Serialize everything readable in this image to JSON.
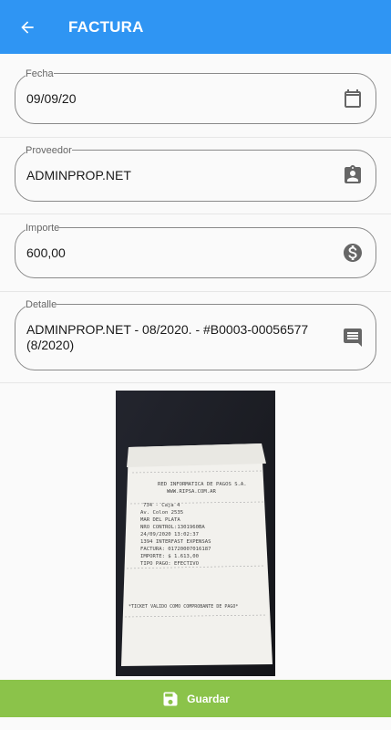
{
  "appbar": {
    "title": "FACTURA",
    "back_icon": "arrow-back-icon"
  },
  "fields": {
    "fecha": {
      "label": "Fecha",
      "value": "09/09/20",
      "icon": "calendar-icon"
    },
    "proveedor": {
      "label": "Proveedor",
      "value": "ADMINPROP.NET",
      "icon": "contact-card-icon"
    },
    "importe": {
      "label": "Importe",
      "value": "600,00",
      "icon": "dollar-circle-icon"
    },
    "detalle": {
      "label": "Detalle",
      "value_line1": "ADMINPROP.NET - 08/2020. - #B0003-00056577",
      "value_line2": "(8/2020)",
      "icon": "comment-icon"
    }
  },
  "receipt": {
    "lines": [
      "RED INFORMATICA DE PAGOS S.A.",
      "WWW.RIPSA.COM.AR",
      "734    - Caja 4",
      "Av. Colon 2535",
      "MAR DEL PLATA",
      "NRO CONTROL:1301960BA",
      "24/09/2020 13:02:37",
      "1394 INTERFAST EXPENSAS",
      "FACTURA: 01720007016187",
      "IMPORTE:     $ 1.613,00",
      "TIPO PAGO: EFECTIVO",
      "*TICKET VALIDO COMO COMPROBANTE DE PAGO*"
    ]
  },
  "save_button": {
    "label": "Guardar",
    "icon": "save-icon"
  },
  "colors": {
    "primary": "#2f95f3",
    "save": "#8bc34a"
  }
}
